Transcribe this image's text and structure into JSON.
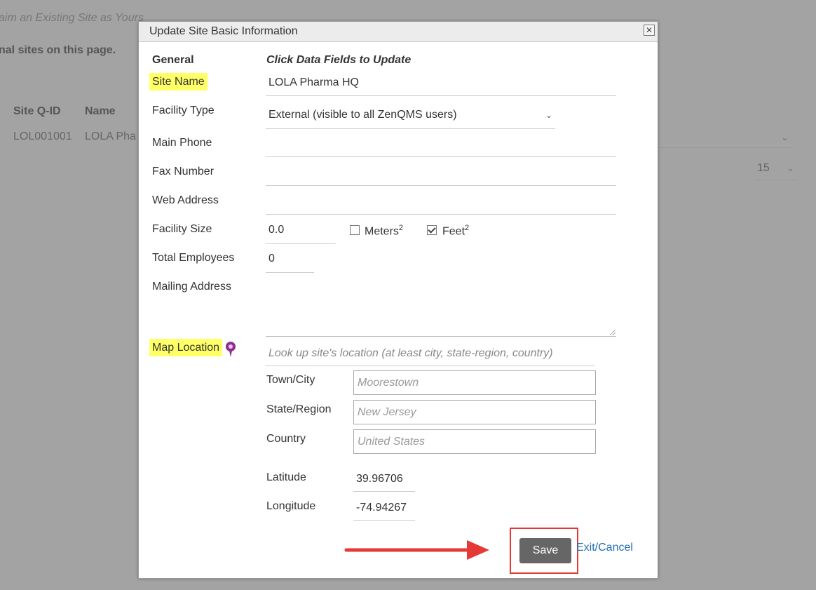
{
  "background": {
    "claim_text": "aim an Existing Site as Yours",
    "note_text": "nal sites on this page.",
    "col_site_qid": "Site Q-ID",
    "col_name": "Name",
    "row_id": "LOL001001",
    "row_name": "LOLA Pha",
    "page_size": "15"
  },
  "dialog": {
    "title": "Update Site Basic Information",
    "close_glyph": "✕",
    "general_heading": "General",
    "click_hint": "Click Data Fields to Update",
    "labels": {
      "site_name": "Site Name",
      "facility_type": "Facility Type",
      "main_phone": "Main Phone",
      "fax_number": "Fax Number",
      "web_address": "Web Address",
      "facility_size": "Facility Size",
      "total_employees": "Total Employees",
      "mailing_address": "Mailing Address",
      "map_location": "Map Location",
      "town_city": "Town/City",
      "state_region": "State/Region",
      "country": "Country",
      "latitude": "Latitude",
      "longitude": "Longitude"
    },
    "values": {
      "site_name": "LOLA Pharma HQ",
      "facility_type": "External (visible to all ZenQMS users)",
      "main_phone": "",
      "fax_number": "",
      "web_address": "",
      "facility_size": "0.0",
      "total_employees": "0",
      "mailing_address": "",
      "latitude": "39.96706",
      "longitude": "-74.94267"
    },
    "units": {
      "meters": "Meters",
      "meters_checked": false,
      "feet": "Feet",
      "feet_checked": true,
      "sup": "2"
    },
    "placeholders": {
      "lookup": "Look up site's location (at least city, state-region, country)",
      "town_city": "Moorestown",
      "state_region": "New Jersey",
      "country": "United States"
    },
    "buttons": {
      "save": "Save",
      "exit": "Exit/Cancel"
    }
  },
  "colors": {
    "highlight": "#ffff66",
    "save_bg": "#666666",
    "annotation_red": "#e53935",
    "pin_purple": "#8e2d8f",
    "link": "#1f6fb2"
  }
}
